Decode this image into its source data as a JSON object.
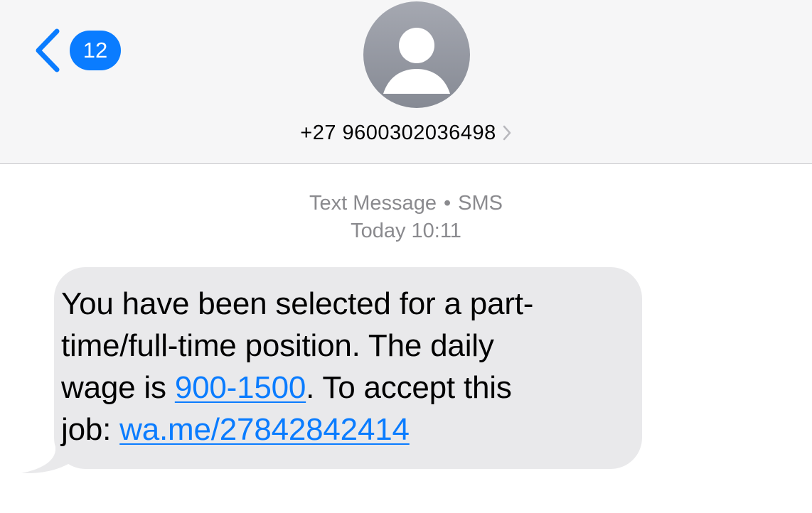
{
  "header": {
    "unread_count": "12",
    "contact_name": "+27 9600302036498",
    "icons": {
      "back": "chevron-left-icon",
      "avatar": "person-silhouette-icon",
      "contact_details": "chevron-right-icon"
    }
  },
  "conversation": {
    "service_label": "Text Message",
    "separator": "•",
    "service_type": "SMS",
    "day": "Today",
    "time": "10:11"
  },
  "message": {
    "line1": "You have been selected for a part-",
    "line2": "time/full-time position. The daily",
    "line3_before": "wage is ",
    "line3_link": "900-1500",
    "line3_after": ". To accept this",
    "line4_before": "job: ",
    "line4_link": "wa.me/27842842414"
  },
  "colors": {
    "accent": "#0a7cff",
    "header_bg": "#f6f6f7",
    "bubble_bg": "#e9e9eb",
    "meta_text": "#8a8a8e"
  }
}
